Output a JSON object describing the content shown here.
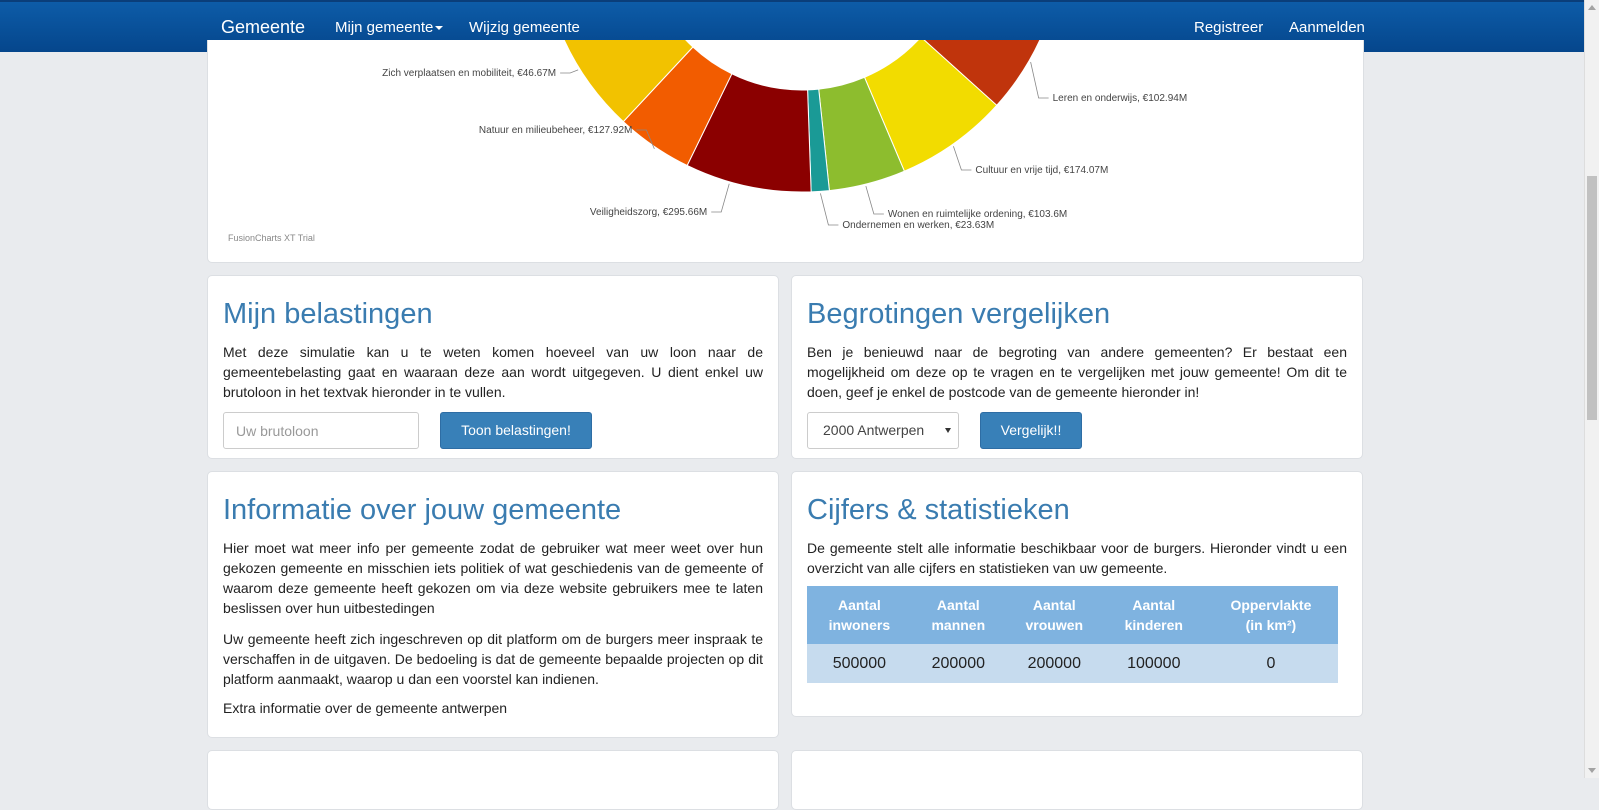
{
  "navbar": {
    "brand": "Gemeente",
    "my_municipality": "Mijn gemeente",
    "change_municipality": "Wijzig gemeente",
    "register": "Registreer",
    "login": "Aanmelden"
  },
  "chart_data": {
    "type": "pie",
    "watermark": "FusionCharts XT Trial",
    "slices": [
      {
        "label": "Leren en onderwijs",
        "value": 102.94,
        "display": "Leren en onderwijs, €102.94M",
        "color": "#c0340c"
      },
      {
        "label": "Cultuur en vrije tijd",
        "value": 174.07,
        "display": "Cultuur en vrije tijd, €174.07M",
        "color": "#f2dc00"
      },
      {
        "label": "Wonen en ruimtelijke ordening",
        "value": 103.6,
        "display": "Wonen en ruimtelijke ordening, €103.6M",
        "color": "#8dbd2e"
      },
      {
        "label": "Ondernemen en werken",
        "value": 23.63,
        "display": "Ondernemen en werken, €23.63M",
        "color": "#1a9a96"
      },
      {
        "label": "Veiligheidszorg",
        "value": 295.66,
        "display": "Veiligheidszorg, €295.66M",
        "color": "#8b0000"
      },
      {
        "label": "Natuur en milieubeheer",
        "value": 127.92,
        "display": "Natuur en milieubeheer, €127.92M",
        "color": "#f25c00"
      },
      {
        "label": "Zich verplaatsen en mobiliteit",
        "value": 46.67,
        "display": "Zich verplaatsen en mobiliteit, €46.67M",
        "color": "#f2c200"
      }
    ]
  },
  "taxes": {
    "title": "Mijn belastingen",
    "text": "Met deze simulatie kan u te weten komen hoeveel van uw loon naar de gemeentebelasting gaat en waaraan deze aan wordt uitgegeven. U dient enkel uw brutoloon in het textvak hieronder in te vullen.",
    "input_placeholder": "Uw brutoloon",
    "button": "Toon belastingen!"
  },
  "compare": {
    "title": "Begrotingen vergelijken",
    "text": "Ben je benieuwd naar de begroting van andere gemeenten? Er bestaat een mogelijkheid om deze op te vragen en te vergelijken met jouw gemeente! Om dit te doen, geef je enkel de postcode van de gemeente hieronder in!",
    "select_value": "2000 Antwerpen",
    "button": "Vergelijk!!"
  },
  "info": {
    "title": "Informatie over jouw gemeente",
    "p1": "Hier moet wat meer info per gemeente zodat de gebruiker wat meer weet over hun gekozen gemeente en misschien iets politiek of wat geschiedenis van de gemeente of waarom deze gemeente heeft gekozen om via deze website gebruikers mee te laten beslissen over hun uitbestedingen",
    "p2": "Uw gemeente heeft zich ingeschreven op dit platform om de burgers meer inspraak te verschaffen in de uitgaven. De bedoeling is dat de gemeente bepaalde projecten op dit platform aanmaakt, waarop u dan een voorstel kan indienen.",
    "p3": "Extra informatie over de gemeente antwerpen"
  },
  "stats": {
    "title": "Cijfers & statistieken",
    "text": "De gemeente stelt alle informatie beschikbaar voor de burgers. Hieronder vindt u een overzicht van alle cijfers en statistieken van uw gemeente.",
    "headers": [
      {
        "l1": "Aantal",
        "l2": "inwoners"
      },
      {
        "l1": "Aantal",
        "l2": "mannen"
      },
      {
        "l1": "Aantal",
        "l2": "vrouwen"
      },
      {
        "l1": "Aantal",
        "l2": "kinderen"
      },
      {
        "l1": "Oppervlakte",
        "l2": "(in km²)"
      }
    ],
    "values": [
      "500000",
      "200000",
      "200000",
      "100000",
      "0"
    ]
  }
}
